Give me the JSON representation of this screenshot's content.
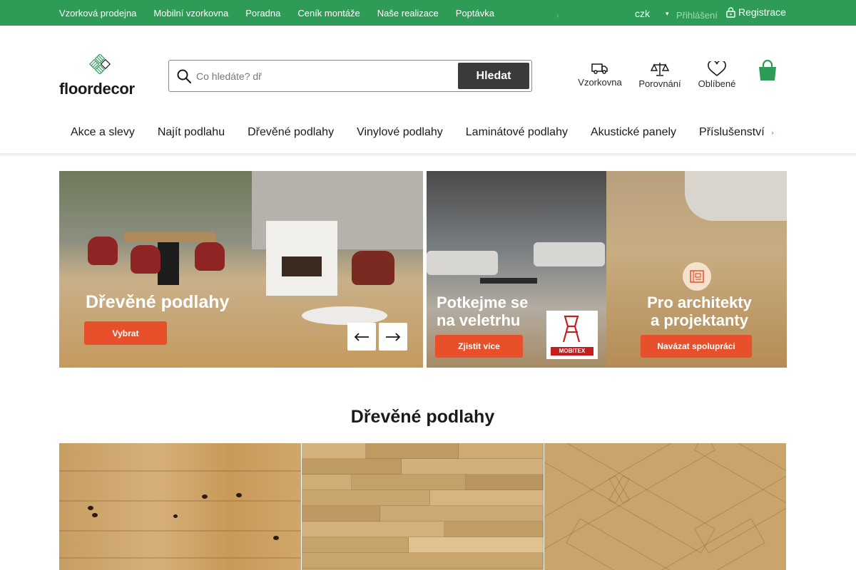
{
  "topbar": {
    "links": [
      "Vzorková prodejna",
      "Mobilní vzorkovna",
      "Poradna",
      "Ceník montáže",
      "Naše realizace",
      "Poptávka"
    ],
    "currency": "czk",
    "login": "Přihlášení",
    "register": "Registrace"
  },
  "logo": {
    "text": "floordecor"
  },
  "search": {
    "placeholder": "Co hledáte? dř",
    "button": "Hledat"
  },
  "header_icons": {
    "vzorkovna": "Vzorkovna",
    "porovnani": "Porovnání",
    "oblibene": "Oblíbené"
  },
  "mainnav": [
    "Akce a slevy",
    "Najít podlahu",
    "Dřevěné podlahy",
    "Vinylové podlahy",
    "Laminátové podlahy",
    "Akustické panely",
    "Příslušenství"
  ],
  "banners": [
    {
      "title": "Dřevěné podlahy",
      "button": "Vybrat"
    },
    {
      "title_line1": "Potkejme se",
      "title_line2": "na veletrhu",
      "button": "Zjistit více",
      "logo": "MOBITEX"
    },
    {
      "title_line1": "Pro architekty",
      "title_line2": "a projektanty",
      "button": "Navázat spolupráci"
    }
  ],
  "section": {
    "title": "Dřevěné podlahy"
  },
  "colors": {
    "brand_green": "#2e9c57",
    "accent_orange": "#e8502b",
    "dark_button": "#3a3a3a"
  },
  "icons": [
    "search-icon",
    "lock-icon",
    "truck-icon",
    "scales-icon",
    "heart-icon",
    "cart-icon",
    "arrow-left-icon",
    "arrow-right-icon",
    "chevron-down-icon",
    "chevron-right-icon"
  ]
}
